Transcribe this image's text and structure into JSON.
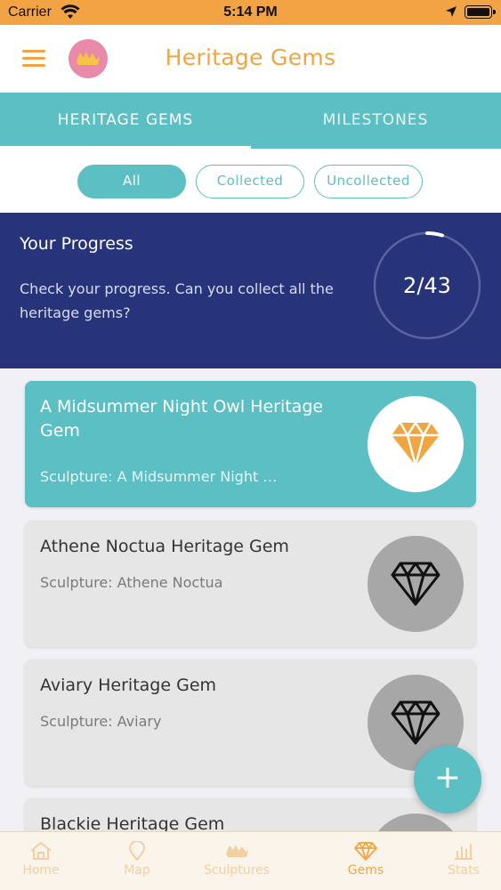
{
  "status_bar": {
    "carrier": "Carrier",
    "time": "5:14 PM"
  },
  "header": {
    "title": "Heritage Gems",
    "menu_icon": "hamburger-menu-icon",
    "logo": "app-logo"
  },
  "tabs": [
    {
      "label": "HERITAGE GEMS",
      "active": true
    },
    {
      "label": "MILESTONES",
      "active": false
    }
  ],
  "filters": [
    {
      "label": "All",
      "selected": true
    },
    {
      "label": "Collected",
      "selected": false
    },
    {
      "label": "Uncollected",
      "selected": false
    }
  ],
  "progress": {
    "title": "Your Progress",
    "description": "Check your progress. Can you collect all the heritage gems?",
    "count_text": "2/43",
    "collected": 2,
    "total": 43
  },
  "gems": [
    {
      "title": "A Midsummer Night Owl Heritage Gem",
      "subtitle": "Sculpture: A Midsummer Night …",
      "collected": true
    },
    {
      "title": "Athene Noctua Heritage Gem",
      "subtitle": "Sculpture: Athene Noctua",
      "collected": false
    },
    {
      "title": "Aviary Heritage Gem",
      "subtitle": "Sculpture: Aviary",
      "collected": false
    },
    {
      "title": "Blackie Heritage Gem",
      "subtitle": "",
      "collected": false
    }
  ],
  "fab": {
    "label": "+"
  },
  "bottom_nav": [
    {
      "label": "Home",
      "icon": "home-icon",
      "active": false
    },
    {
      "label": "Map",
      "icon": "map-pin-icon",
      "active": false
    },
    {
      "label": "Sculptures",
      "icon": "owl-icon",
      "active": false
    },
    {
      "label": "Gems",
      "icon": "diamond-icon",
      "active": true
    },
    {
      "label": "Stats",
      "icon": "bar-chart-icon",
      "active": false
    }
  ],
  "colors": {
    "accent_orange": "#f0a540",
    "teal": "#5bbfc4",
    "navy": "#28347a",
    "status_bar": "#f2a444"
  }
}
